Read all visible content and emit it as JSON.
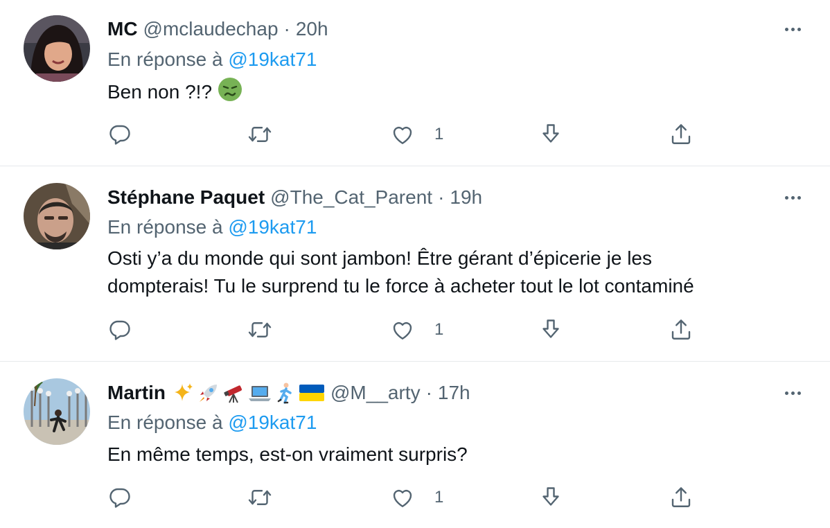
{
  "tweets": [
    {
      "name": "MC",
      "handle": "@mclaudechap",
      "separator": "·",
      "time": "20h",
      "reply_prefix": "En réponse à",
      "reply_to": "@19kat71",
      "text_lines": [
        "Ben non ?!?"
      ],
      "text_emoji": "nauseated-face-emoji",
      "name_emojis": [],
      "like_count": "1",
      "avatar": "avatar-woman-dark-hair"
    },
    {
      "name": "Stéphane Paquet",
      "handle": "@The_Cat_Parent",
      "separator": "·",
      "time": "19h",
      "reply_prefix": "En réponse à",
      "reply_to": "@19kat71",
      "text_lines": [
        "Osti y’a du monde qui sont jambon! Être gérant d’épicerie je les",
        "dompterais! Tu le surprend tu le force à acheter tout le lot contaminé"
      ],
      "name_emojis": [],
      "like_count": "1",
      "avatar": "avatar-man-bald"
    },
    {
      "name": "Martin",
      "handle": "@M__arty",
      "separator": "·",
      "time": "17h",
      "reply_prefix": "En réponse à",
      "reply_to": "@19kat71",
      "text_lines": [
        "En même temps, est-on vraiment surpris?"
      ],
      "name_emojis": [
        "sparkles-emoji",
        "rocket-emoji",
        "telescope-emoji",
        "laptop-emoji",
        "runner-emoji",
        "ukraine-flag-emoji"
      ],
      "like_count": "1",
      "avatar": "avatar-street-lamps"
    }
  ],
  "icons": {
    "reply": "reply-icon",
    "retweet": "retweet-icon",
    "like": "heart-icon",
    "downvote": "downvote-icon",
    "share": "share-icon",
    "more": "more-icon"
  },
  "colors": {
    "link": "#1d9bf0",
    "secondary_text": "#536471",
    "divider": "#e6e9ec"
  }
}
